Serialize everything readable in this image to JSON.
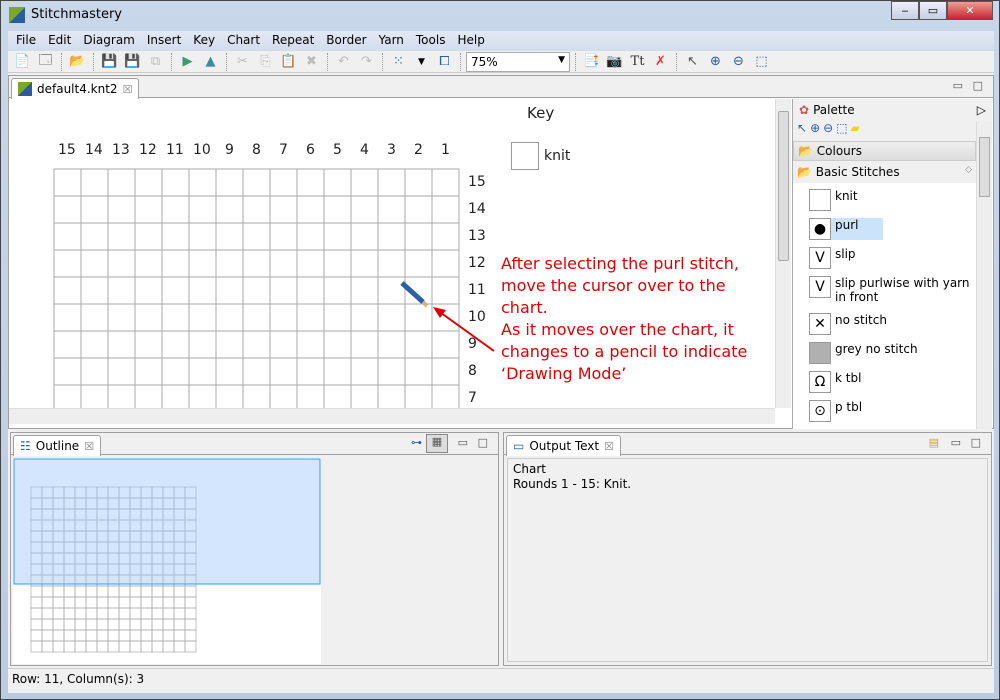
{
  "window": {
    "title": "Stitchmastery",
    "buttons": [
      "‒",
      "▭",
      "✕"
    ]
  },
  "menu": [
    "File",
    "Edit",
    "Diagram",
    "Insert",
    "Key",
    "Chart",
    "Repeat",
    "Border",
    "Yarn",
    "Tools",
    "Help"
  ],
  "toolbar": {
    "zoom": "75%"
  },
  "editor": {
    "tab": "default4.knt2",
    "key_title": "Key",
    "key_items": [
      "knit"
    ],
    "column_labels": [
      "15",
      "14",
      "13",
      "12",
      "11",
      "10",
      "9",
      "8",
      "7",
      "6",
      "5",
      "4",
      "3",
      "2",
      "1"
    ],
    "row_labels": [
      "15",
      "14",
      "13",
      "12",
      "11",
      "10",
      "9",
      "8",
      "7"
    ],
    "annotation": "After selecting the purl stitch,\nmove the cursor over to the\nchart.\nAs it moves over the chart, it\nchanges to a pencil to indicate\n‘Drawing Mode’",
    "annotation_color": "#e00000"
  },
  "palette": {
    "title": "Palette",
    "drawers": [
      "Colours",
      "Basic Stitches"
    ],
    "items": [
      {
        "label": "knit",
        "symbol": ""
      },
      {
        "label": "purl",
        "symbol": "●",
        "selected": true
      },
      {
        "label": "slip",
        "symbol": "V"
      },
      {
        "label": "slip purlwise with yarn in front",
        "symbol": "V"
      },
      {
        "label": "no stitch",
        "symbol": "✕"
      },
      {
        "label": "grey no stitch",
        "symbol": ""
      },
      {
        "label": "k tbl",
        "symbol": "Ω"
      },
      {
        "label": "p tbl",
        "symbol": "⊙"
      }
    ]
  },
  "outline": {
    "tab": "Outline"
  },
  "output": {
    "tab": "Output Text",
    "lines": [
      "Chart",
      "Rounds 1 - 15: Knit."
    ]
  },
  "status": "Row: 11, Column(s): 3"
}
